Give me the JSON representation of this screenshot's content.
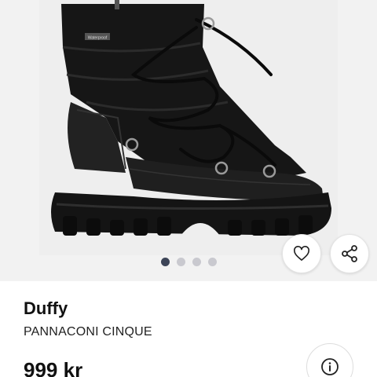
{
  "product": {
    "brand": "Duffy",
    "name": "PANNACONI CINQUE",
    "price": "999 kr",
    "image_icon": "black-lace-up-snow-boot-image",
    "label_on_boot": "Waterproof"
  },
  "gallery": {
    "page_count": 4,
    "active_index": 0
  },
  "actions": {
    "favorite_icon": "heart-icon",
    "share_icon": "share-icon",
    "info_icon": "info-icon"
  },
  "colors": {
    "dot_active": "#3c4457",
    "dot_inactive": "#c9c9cf",
    "image_bg": "#eeeeee"
  }
}
